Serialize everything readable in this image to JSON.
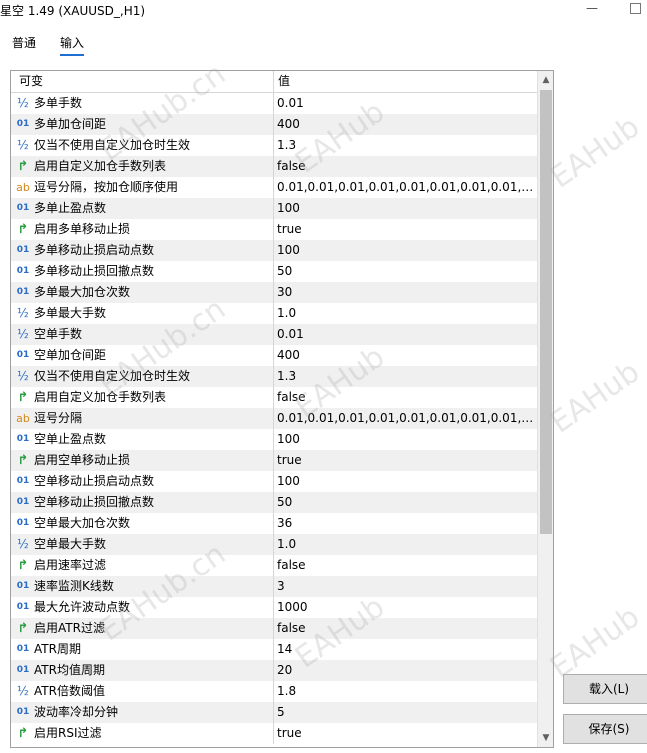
{
  "window": {
    "title": "星空 1.49 (XAUUSD_,H1)",
    "minimize_glyph": "—"
  },
  "tabs": [
    {
      "label": "普通"
    },
    {
      "label": "输入"
    }
  ],
  "table": {
    "headers": {
      "variable": "可变",
      "value": "值"
    },
    "rows": [
      {
        "icon": "½",
        "type": "fraction",
        "name": "多单手数",
        "value": "0.01"
      },
      {
        "icon": "01",
        "type": "integer",
        "name": "多单加仓间距",
        "value": "400"
      },
      {
        "icon": "½",
        "type": "fraction",
        "name": "仅当不使用自定义加仓时生效",
        "value": "1.3"
      },
      {
        "icon": "↱",
        "type": "bool",
        "name": "启用自定义加仓手数列表",
        "value": "false"
      },
      {
        "icon": "ab",
        "type": "string",
        "name": "逗号分隔，按加仓顺序使用",
        "value": "0.01,0.01,0.01,0.01,0.01,0.01,0.01,0.01,0.02,..."
      },
      {
        "icon": "01",
        "type": "integer",
        "name": "多单止盈点数",
        "value": "100"
      },
      {
        "icon": "↱",
        "type": "bool",
        "name": "启用多单移动止损",
        "value": "true"
      },
      {
        "icon": "01",
        "type": "integer",
        "name": "多单移动止损启动点数",
        "value": "100"
      },
      {
        "icon": "01",
        "type": "integer",
        "name": "多单移动止损回撤点数",
        "value": "50"
      },
      {
        "icon": "01",
        "type": "integer",
        "name": "多单最大加仓次数",
        "value": "30"
      },
      {
        "icon": "½",
        "type": "fraction",
        "name": "多单最大手数",
        "value": "1.0"
      },
      {
        "icon": "½",
        "type": "fraction",
        "name": "空单手数",
        "value": "0.01"
      },
      {
        "icon": "01",
        "type": "integer",
        "name": "空单加仓间距",
        "value": "400"
      },
      {
        "icon": "½",
        "type": "fraction",
        "name": "仅当不使用自定义加仓时生效",
        "value": "1.3"
      },
      {
        "icon": "↱",
        "type": "bool",
        "name": "启用自定义加仓手数列表",
        "value": "false"
      },
      {
        "icon": "ab",
        "type": "string",
        "name": "逗号分隔",
        "value": "0.01,0.01,0.01,0.01,0.01,0.01,0.01,0.01,0.02,..."
      },
      {
        "icon": "01",
        "type": "integer",
        "name": "空单止盈点数",
        "value": "100"
      },
      {
        "icon": "↱",
        "type": "bool",
        "name": "启用空单移动止损",
        "value": "true"
      },
      {
        "icon": "01",
        "type": "integer",
        "name": "空单移动止损启动点数",
        "value": "100"
      },
      {
        "icon": "01",
        "type": "integer",
        "name": "空单移动止损回撤点数",
        "value": "50"
      },
      {
        "icon": "01",
        "type": "integer",
        "name": "空单最大加仓次数",
        "value": "36"
      },
      {
        "icon": "½",
        "type": "fraction",
        "name": "空单最大手数",
        "value": "1.0"
      },
      {
        "icon": "↱",
        "type": "bool",
        "name": "启用速率过滤",
        "value": "false"
      },
      {
        "icon": "01",
        "type": "integer",
        "name": "速率监测K线数",
        "value": "3"
      },
      {
        "icon": "01",
        "type": "integer",
        "name": "最大允许波动点数",
        "value": "1000"
      },
      {
        "icon": "↱",
        "type": "bool",
        "name": "启用ATR过滤",
        "value": "false"
      },
      {
        "icon": "01",
        "type": "integer",
        "name": "ATR周期",
        "value": "14"
      },
      {
        "icon": "01",
        "type": "integer",
        "name": "ATR均值周期",
        "value": "20"
      },
      {
        "icon": "½",
        "type": "fraction",
        "name": "ATR倍数阈值",
        "value": "1.8"
      },
      {
        "icon": "01",
        "type": "integer",
        "name": "波动率冷却分钟",
        "value": "5"
      },
      {
        "icon": "↱",
        "type": "bool",
        "name": "启用RSI过滤",
        "value": "true"
      }
    ]
  },
  "scrollbar": {
    "up_glyph": "▲",
    "down_glyph": "▼",
    "position": 0.0
  },
  "buttons": {
    "load": "载入(L)",
    "save": "保存(S)"
  },
  "watermark": {
    "text_cn": "EAHub.cn",
    "text": "EAHub"
  },
  "colors": {
    "tab_accent": "#1f6fd2",
    "num_icon": "#2a6cc7",
    "bool_icon": "#2f9e44",
    "str_icon": "#d08a1c",
    "alt_row": "#f0f0f0"
  }
}
